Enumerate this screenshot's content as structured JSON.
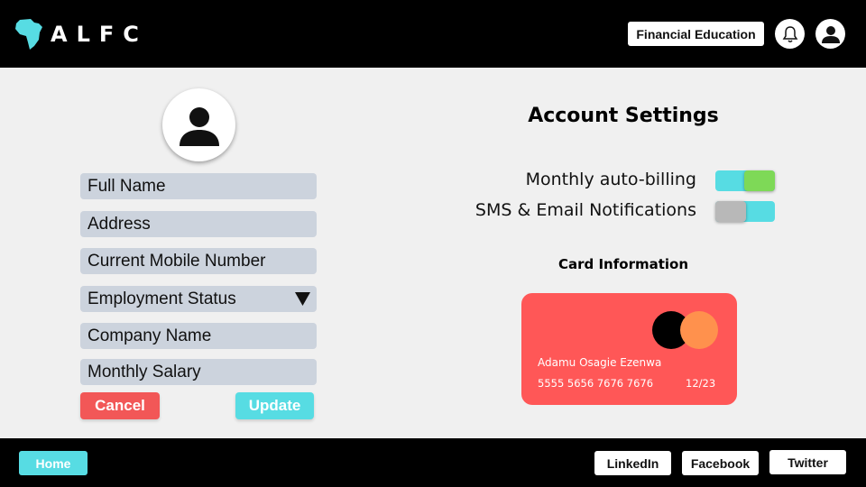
{
  "header": {
    "logo_text": "ALFC",
    "financial_education_label": "Financial Education",
    "icons": {
      "logo": "africa-map-icon",
      "bell": "bell-icon",
      "user": "user-icon"
    }
  },
  "profile": {
    "avatar_icon": "user-icon",
    "fields": {
      "full_name": "Full Name",
      "address": "Address",
      "mobile": "Current Mobile Number",
      "employment_status": "Employment Status",
      "company_name": "Company Name",
      "monthly_salary": "Monthly Salary"
    },
    "cancel_label": "Cancel",
    "update_label": "Update"
  },
  "settings": {
    "title": "Account Settings",
    "toggles": [
      {
        "label": "Monthly auto-billing",
        "on": true
      },
      {
        "label": "SMS & Email Notifications",
        "on": false
      }
    ],
    "card_info_title": "Card Information"
  },
  "card": {
    "holder": "Adamu Osagie Ezenwa",
    "number": "5555 5656 7676 7676",
    "expiry": "12/23",
    "brand_icon": "mastercard-icon"
  },
  "footer": {
    "home_label": "Home",
    "linkedin_label": "LinkedIn",
    "facebook_label": "Facebook",
    "twitter_label": "Twitter"
  },
  "colors": {
    "accent": "#57dce3",
    "danger": "#f25757",
    "card": "#ff5757",
    "toggle_on": "#7ed957",
    "field": "#ccd3dd"
  }
}
